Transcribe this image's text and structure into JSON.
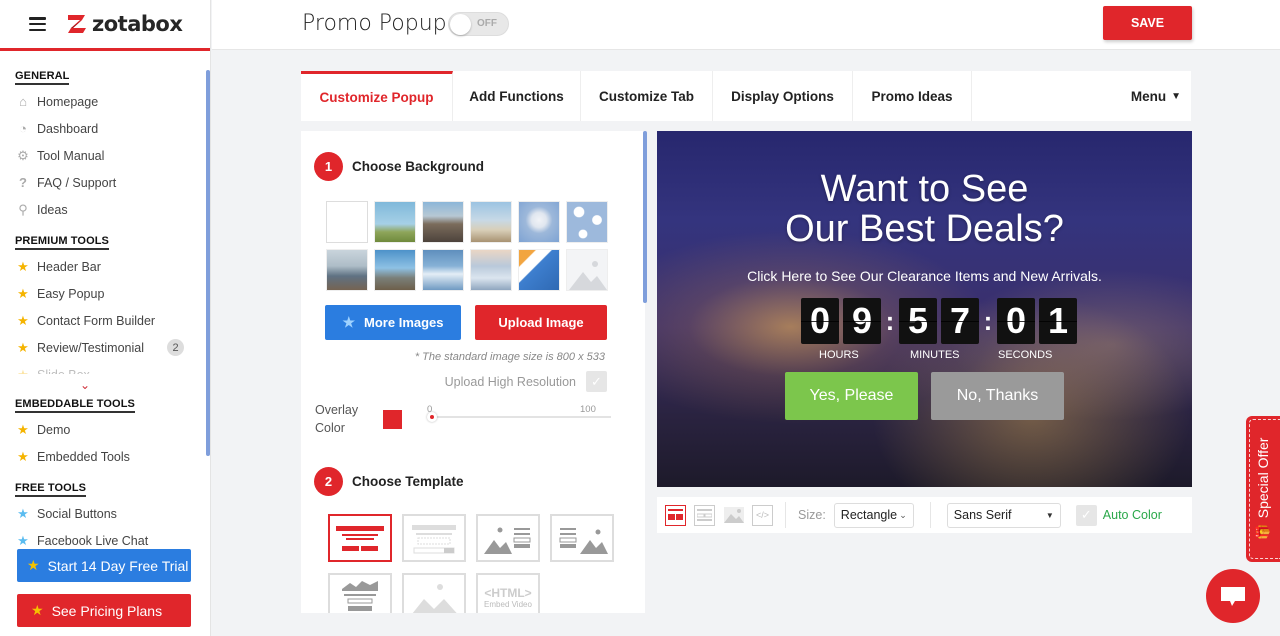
{
  "brand": {
    "name": "zotabox",
    "menu_icon": "hamburger-icon"
  },
  "sidebar": {
    "sections": [
      {
        "title": "GENERAL",
        "items": [
          {
            "label": "Homepage",
            "icon": "home-icon"
          },
          {
            "label": "Dashboard",
            "icon": "dashboard-icon"
          },
          {
            "label": "Tool Manual",
            "icon": "gear-icon"
          },
          {
            "label": "FAQ / Support",
            "icon": "question-icon"
          },
          {
            "label": "Ideas",
            "icon": "lightbulb-icon"
          }
        ]
      },
      {
        "title": "PREMIUM TOOLS",
        "items": [
          {
            "label": "Header Bar",
            "icon": "star-icon"
          },
          {
            "label": "Easy Popup",
            "icon": "star-icon"
          },
          {
            "label": "Contact Form Builder",
            "icon": "star-icon"
          },
          {
            "label": "Review/Testimonial",
            "icon": "star-icon",
            "badge": "2"
          },
          {
            "label": "Slide Box",
            "icon": "star-icon"
          }
        ]
      },
      {
        "title": "EMBEDDABLE TOOLS",
        "items": [
          {
            "label": "Demo",
            "icon": "star-icon"
          },
          {
            "label": "Embedded Tools",
            "icon": "star-icon"
          }
        ]
      },
      {
        "title": "FREE TOOLS",
        "items": [
          {
            "label": "Social Buttons",
            "icon": "star-icon"
          },
          {
            "label": "Facebook Live Chat",
            "icon": "star-icon"
          }
        ]
      }
    ],
    "trial_button": "Start 14 Day Free Trial",
    "pricing_button": "See Pricing Plans"
  },
  "header": {
    "title": "Promo Popup",
    "toggle_state": "OFF",
    "save_label": "SAVE"
  },
  "tabs": [
    {
      "label": "Customize Popup",
      "active": true
    },
    {
      "label": "Add Functions",
      "active": false
    },
    {
      "label": "Customize Tab",
      "active": false
    },
    {
      "label": "Display Options",
      "active": false
    },
    {
      "label": "Promo Ideas",
      "active": false
    }
  ],
  "menu_label": "Menu",
  "customize": {
    "step1": {
      "number": "1",
      "title": "Choose Background"
    },
    "more_images": "More Images",
    "upload_image": "Upload Image",
    "size_note": "* The standard image size is 800 x 533",
    "high_res_label": "Upload High Resolution",
    "overlay_label_1": "Overlay",
    "overlay_label_2": "Color",
    "overlay_color": "#e0262b",
    "slider_min": "0",
    "slider_max": "100",
    "slider_value": 0,
    "step2": {
      "number": "2",
      "title": "Choose Template"
    },
    "html_template_label": "<HTML>",
    "html_template_sub": "Embed Video"
  },
  "preview": {
    "title_line1": "Want to See",
    "title_line2": "Our Best Deals?",
    "subtitle": "Click Here to See Our Clearance Items and New Arrivals.",
    "timer": {
      "h1": "0",
      "h2": "9",
      "m1": "5",
      "m2": "7",
      "s1": "0",
      "s2": "1"
    },
    "labels": {
      "hours": "HOURS",
      "minutes": "MINUTES",
      "seconds": "SECONDS"
    },
    "yes_button": "Yes, Please",
    "no_button": "No, Thanks",
    "yes_color": "#7cc64c",
    "no_color": "#9a9a9a"
  },
  "preview_toolbar": {
    "size_label": "Size:",
    "size_value": "Rectangle",
    "font_value": "Sans Serif",
    "auto_color_label": "Auto Color"
  },
  "special_offer": "Special Offer"
}
